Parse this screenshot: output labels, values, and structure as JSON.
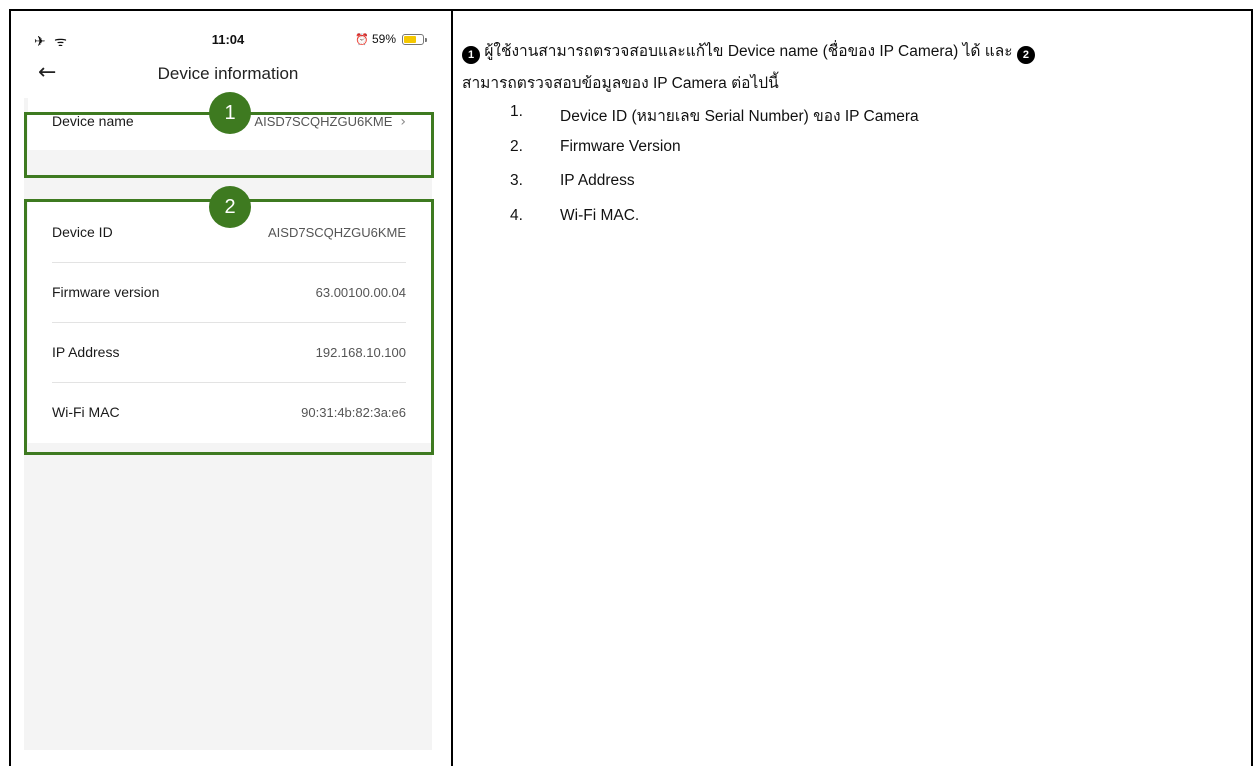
{
  "phone": {
    "status_bar": {
      "icons_left": "✈ ᯤ",
      "time": "11:04",
      "alarm_icon": "alarm-clock-icon",
      "battery_text": "59%",
      "battery_level": 0.59,
      "battery_color": "#f5c800"
    },
    "nav": {
      "title": "Device information",
      "back_icon": "back-arrow-icon"
    },
    "device_name_row": {
      "label": "Device name",
      "value": "AISD7SCQHZGU6KME",
      "chevron": "›"
    },
    "info_rows": [
      {
        "label": "Device ID",
        "value": "AISD7SCQHZGU6KME"
      },
      {
        "label": "Firmware version",
        "value": "63.00100.00.04"
      },
      {
        "label": "IP Address",
        "value": "192.168.10.100"
      },
      {
        "label": "Wi-Fi MAC",
        "value": "90:31:4b:82:3a:e6"
      }
    ],
    "badges": [
      "1",
      "2"
    ],
    "highlight_color": "#3e7a20"
  },
  "description": {
    "marker1": "1",
    "line1": "ผู้ใช้งานสามารถตรวจสอบและแก้ไข Device name (ชื่อของ IP Camera) ได้ และ",
    "marker2": "2",
    "line2": "สามารถตรวจสอบข้อมูลของ IP Camera ต่อไปนี้",
    "items": [
      {
        "num": "1.",
        "text": "Device ID (หมายเลข Serial Number) ของ IP Camera"
      },
      {
        "num": "2.",
        "text": "Firmware Version"
      },
      {
        "num": "3.",
        "text": "IP Address"
      },
      {
        "num": "4.",
        "text": "Wi-Fi MAC."
      }
    ]
  }
}
